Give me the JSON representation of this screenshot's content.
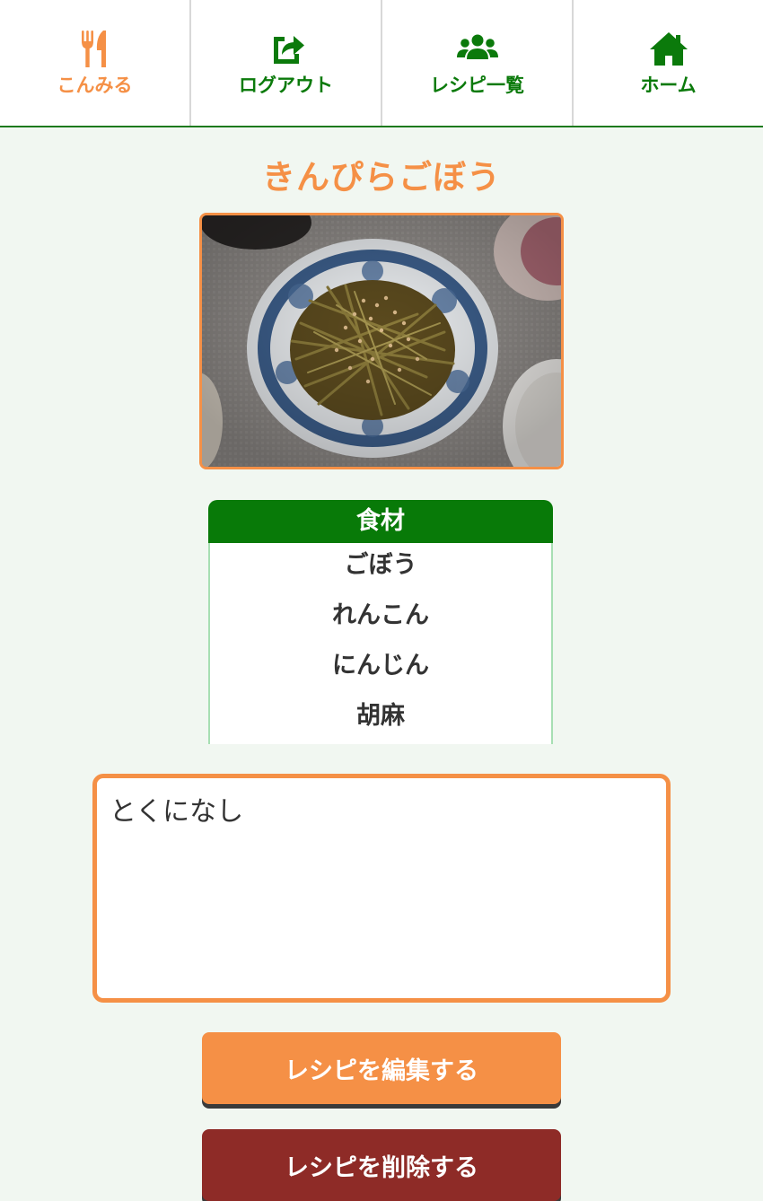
{
  "nav": {
    "items": [
      {
        "label": "こんみる",
        "icon": "fork-knife-icon",
        "color": "#f59046"
      },
      {
        "label": "ログアウト",
        "icon": "logout-share-icon",
        "color": "#0b7a0b"
      },
      {
        "label": "レシピ一覧",
        "icon": "users-group-icon",
        "color": "#0b7a0b"
      },
      {
        "label": "ホーム",
        "icon": "home-icon",
        "color": "#0b7a0b"
      }
    ]
  },
  "recipe": {
    "title": "きんぴらごぼう",
    "image_icon": "recipe-photo",
    "ingredients_header": "食材",
    "ingredients": [
      "ごぼう",
      "れんこん",
      "にんじん",
      "胡麻"
    ],
    "memo": "とくになし"
  },
  "actions": {
    "edit_label": "レシピを編集する",
    "delete_label": "レシピを削除する"
  },
  "colors": {
    "accent": "#f59046",
    "brand_green": "#087a08",
    "danger": "#8e2b27",
    "background": "#f1f7f1"
  }
}
